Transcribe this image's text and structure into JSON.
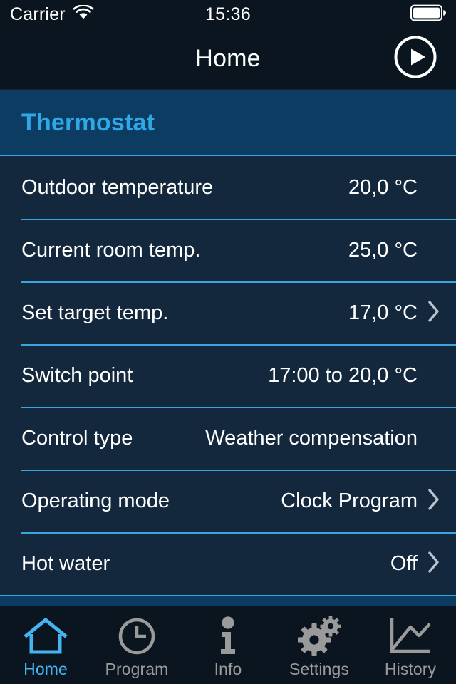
{
  "status_bar": {
    "carrier": "Carrier",
    "wifi_icon": "wifi-icon",
    "time": "15:36",
    "battery_icon": "battery-full-icon"
  },
  "nav_bar": {
    "title": "Home",
    "action_icon": "play-circle-icon",
    "action_name": "play-button"
  },
  "section": {
    "title": "Thermostat"
  },
  "rows": [
    {
      "label": "Outdoor temperature",
      "value": "20,0 °C",
      "chevron": false,
      "name": "row-outdoor-temperature"
    },
    {
      "label": "Current room temp.",
      "value": "25,0 °C",
      "chevron": false,
      "name": "row-current-room-temp"
    },
    {
      "label": "Set target temp.",
      "value": "17,0 °C",
      "chevron": true,
      "name": "row-set-target-temp"
    },
    {
      "label": "Switch point",
      "value": "17:00 to 20,0 °C",
      "chevron": false,
      "name": "row-switch-point"
    },
    {
      "label": "Control type",
      "value": "Weather compensation",
      "chevron": false,
      "name": "row-control-type"
    },
    {
      "label": "Operating mode",
      "value": "Clock Program",
      "chevron": true,
      "name": "row-operating-mode"
    },
    {
      "label": "Hot water",
      "value": "Off",
      "chevron": true,
      "name": "row-hot-water"
    }
  ],
  "tabs": [
    {
      "label": "Home",
      "icon": "house-icon",
      "active": true
    },
    {
      "label": "Program",
      "icon": "clock-icon",
      "active": false
    },
    {
      "label": "Info",
      "icon": "info-icon",
      "active": false
    },
    {
      "label": "Settings",
      "icon": "gears-icon",
      "active": false
    },
    {
      "label": "History",
      "icon": "line-chart-icon",
      "active": false
    }
  ],
  "colors": {
    "nav_background": "#0a151f",
    "section_background": "#0d3c63",
    "list_background": "#13283d",
    "separator": "#3aa6e0",
    "accent": "#2fa8e8",
    "tab_active": "#45b4f0",
    "tab_inactive": "#9a9a9a",
    "text": "#ffffff"
  }
}
